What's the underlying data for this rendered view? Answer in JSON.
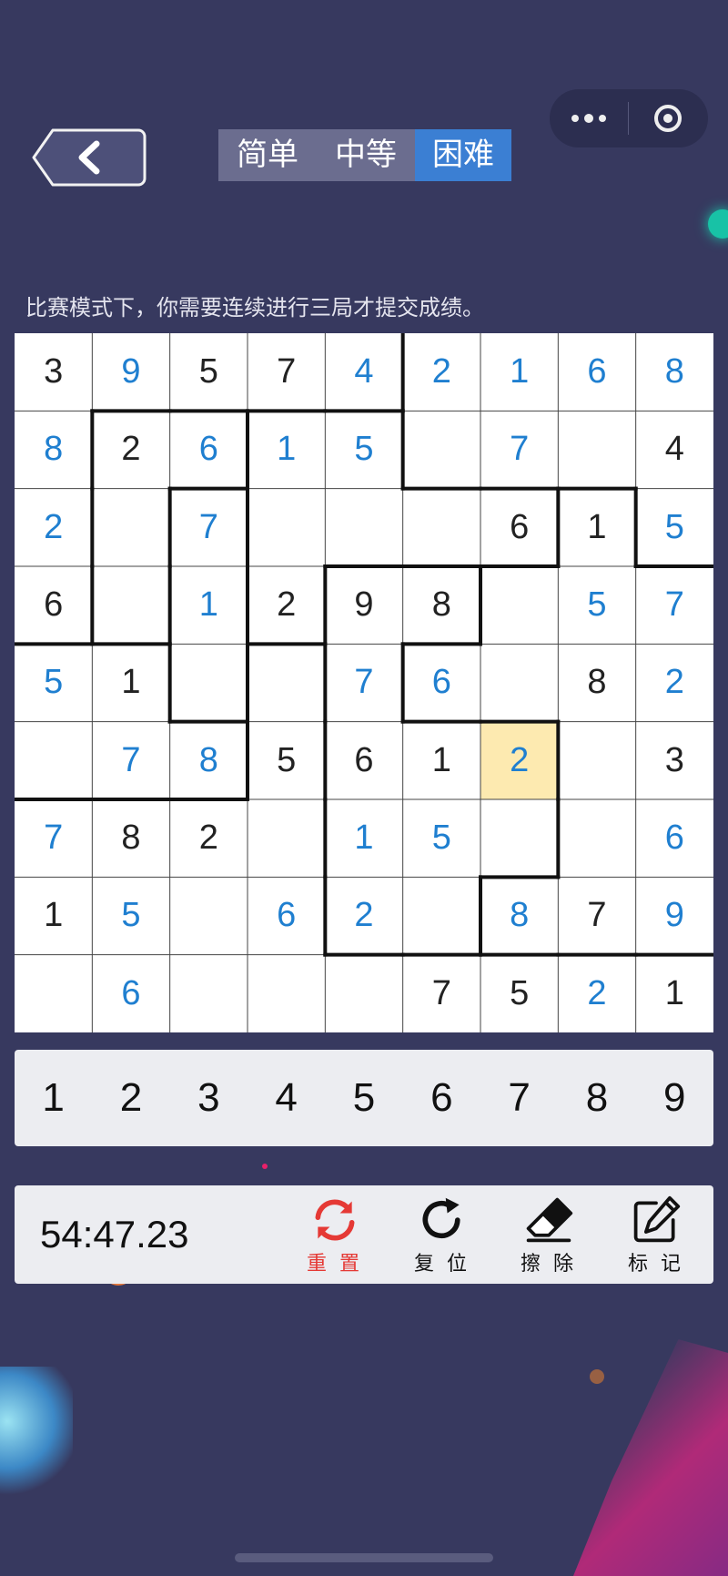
{
  "tabs": {
    "easy": "简单",
    "medium": "中等",
    "hard": "困难",
    "active": "hard"
  },
  "hint": "比赛模式下，你需要连续进行三局才提交成绩。",
  "board": {
    "values": [
      [
        "3",
        "9",
        "5",
        "7",
        "4",
        "2",
        "1",
        "6",
        "8"
      ],
      [
        "8",
        "2",
        "6",
        "1",
        "5",
        "",
        "7",
        "",
        "4"
      ],
      [
        "2",
        "",
        "7",
        "",
        "",
        "",
        "6",
        "1",
        "5"
      ],
      [
        "6",
        "",
        "1",
        "2",
        "9",
        "8",
        "",
        "5",
        "7"
      ],
      [
        "5",
        "1",
        "",
        "",
        "7",
        "6",
        "",
        "8",
        "2"
      ],
      [
        "",
        "7",
        "8",
        "5",
        "6",
        "1",
        "2",
        "",
        "3"
      ],
      [
        "7",
        "8",
        "2",
        "",
        "1",
        "5",
        "",
        "",
        "6"
      ],
      [
        "1",
        "5",
        "",
        "6",
        "2",
        "",
        "8",
        "7",
        "9"
      ],
      [
        "",
        "6",
        "",
        "",
        "",
        "7",
        "5",
        "2",
        "1"
      ]
    ],
    "user_entered": [
      [
        0,
        1,
        0,
        0,
        1,
        1,
        1,
        1,
        1
      ],
      [
        1,
        0,
        1,
        1,
        1,
        0,
        1,
        0,
        0
      ],
      [
        1,
        0,
        1,
        0,
        0,
        0,
        0,
        0,
        1
      ],
      [
        0,
        0,
        1,
        0,
        0,
        0,
        0,
        1,
        1
      ],
      [
        1,
        0,
        0,
        0,
        1,
        1,
        0,
        0,
        1
      ],
      [
        0,
        1,
        1,
        0,
        0,
        0,
        1,
        0,
        0
      ],
      [
        1,
        0,
        0,
        0,
        1,
        1,
        0,
        0,
        1
      ],
      [
        0,
        1,
        0,
        1,
        1,
        0,
        1,
        0,
        1
      ],
      [
        0,
        1,
        0,
        0,
        0,
        0,
        0,
        1,
        0
      ]
    ],
    "regions": [
      [
        0,
        0,
        0,
        0,
        0,
        1,
        1,
        1,
        1
      ],
      [
        0,
        2,
        2,
        3,
        3,
        1,
        1,
        1,
        1
      ],
      [
        0,
        2,
        4,
        3,
        3,
        3,
        3,
        5,
        1
      ],
      [
        0,
        2,
        4,
        3,
        6,
        6,
        5,
        5,
        5
      ],
      [
        7,
        7,
        4,
        8,
        6,
        5,
        5,
        5,
        5
      ],
      [
        7,
        7,
        7,
        8,
        6,
        6,
        6,
        5,
        5
      ],
      [
        8,
        8,
        8,
        8,
        6,
        6,
        6,
        5,
        5
      ],
      [
        8,
        8,
        8,
        8,
        6,
        6,
        5,
        5,
        5
      ],
      [
        8,
        8,
        8,
        8,
        8,
        8,
        8,
        8,
        8
      ]
    ],
    "selected_row": 5,
    "selected_col": 6,
    "colors": {
      "user": "#1f7fd0",
      "given": "#222222",
      "selected_bg": "#fdeab0"
    }
  },
  "numpad": [
    "1",
    "2",
    "3",
    "4",
    "5",
    "6",
    "7",
    "8",
    "9"
  ],
  "toolbar": {
    "timer": "54:47.23",
    "reset_label": "重 置",
    "restore_label": "复 位",
    "erase_label": "擦 除",
    "mark_label": "标 记"
  },
  "icons": {
    "back": "chevron-left-icon",
    "more": "more-dots-icon",
    "close": "target-ring-icon",
    "reset": "refresh-arrows-icon",
    "restore": "rotate-cw-icon",
    "erase": "eraser-icon",
    "mark": "edit-pencil-icon"
  }
}
